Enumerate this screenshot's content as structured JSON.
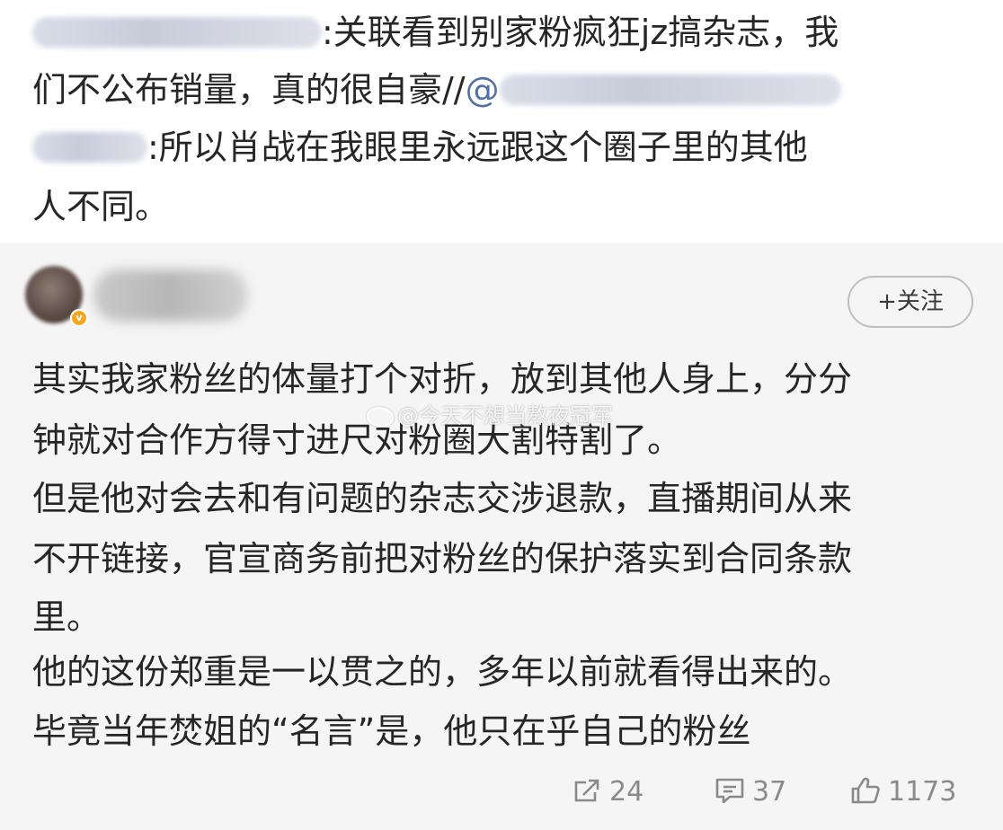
{
  "quoted_chain": {
    "line1_text": ":关联看到别家粉疯狂jz搞杂志，我",
    "line2_text": "们不公布销量，真的很自豪//",
    "line2_at": "@",
    "line3_text": ":所以肖战在我眼里永远跟这个圈子里的其他",
    "line4_text": "人不同。"
  },
  "post": {
    "follow_label": "+关注",
    "content_lines": [
      "其实我家粉丝的体量打个对折，放到其他人身上，分分",
      "钟就对合作方得寸进尺对粉圈大割特割了。",
      "但是他对会去和有问题的杂志交涉退款，直播期间从来",
      "不开链接，官宣商务前把对粉丝的保护落实到合同条款",
      "里。",
      "他的这份郑重是一以贯之的，多年以前就看得出来的。",
      "毕竟当年焚姐的“名言”是，他只在乎自己的粉丝"
    ],
    "watermark": "@今天不想当熬夜冠军",
    "verified_badge": "v"
  },
  "actions": {
    "repost_count": "24",
    "comment_count": "37",
    "like_count": "1173"
  },
  "colors": {
    "username_link": "#5470a8",
    "card_background": "#f5f5f5",
    "action_gray": "#8a8a8a",
    "verified_badge": "#f5a623"
  },
  "icons": {
    "repost": "share-arrow-icon",
    "comment": "comment-bubble-icon",
    "like": "thumbs-up-icon"
  }
}
